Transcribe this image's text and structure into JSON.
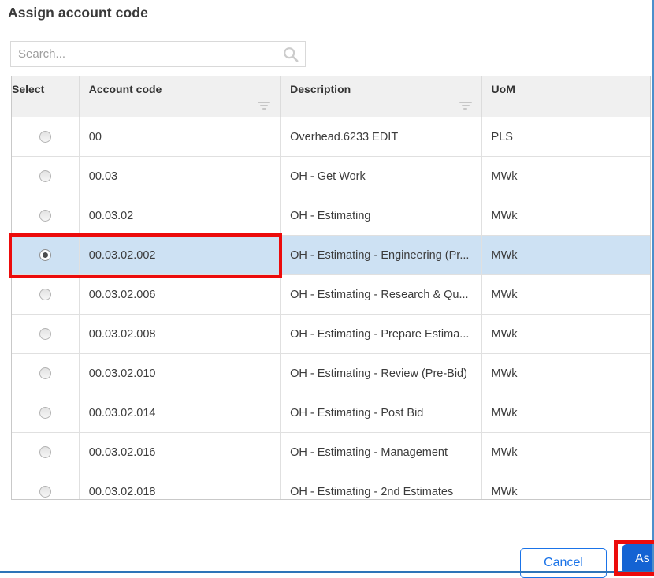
{
  "dialog": {
    "title": "Assign account code",
    "search": {
      "placeholder": "Search..."
    },
    "table": {
      "columns": [
        {
          "key": "select",
          "label": "Select",
          "filter": false
        },
        {
          "key": "code",
          "label": "Account code",
          "filter": true
        },
        {
          "key": "description",
          "label": "Description",
          "filter": true
        },
        {
          "key": "uom",
          "label": "UoM",
          "filter": false
        }
      ],
      "rows": [
        {
          "code": "00",
          "description": "Overhead.6233 EDIT",
          "uom": "PLS",
          "selected": false
        },
        {
          "code": "00.03",
          "description": "OH - Get Work",
          "uom": "MWk",
          "selected": false
        },
        {
          "code": "00.03.02",
          "description": "OH - Estimating",
          "uom": "MWk",
          "selected": false
        },
        {
          "code": "00.03.02.002",
          "description": "OH - Estimating - Engineering (Pr...",
          "uom": "MWk",
          "selected": true
        },
        {
          "code": "00.03.02.006",
          "description": "OH - Estimating - Research & Qu...",
          "uom": "MWk",
          "selected": false
        },
        {
          "code": "00.03.02.008",
          "description": "OH - Estimating - Prepare Estima...",
          "uom": "MWk",
          "selected": false
        },
        {
          "code": "00.03.02.010",
          "description": "OH - Estimating - Review (Pre-Bid)",
          "uom": "MWk",
          "selected": false
        },
        {
          "code": "00.03.02.014",
          "description": "OH - Estimating - Post Bid",
          "uom": "MWk",
          "selected": false
        },
        {
          "code": "00.03.02.016",
          "description": "OH - Estimating - Management",
          "uom": "MWk",
          "selected": false
        },
        {
          "code": "00.03.02.018",
          "description": "OH - Estimating - 2nd Estimates",
          "uom": "MWk",
          "selected": false
        }
      ]
    },
    "buttons": {
      "cancel": "Cancel",
      "assign_visible": "As"
    },
    "colors": {
      "accent_blue": "#1a73e8",
      "assign_button_bg": "#1463d3",
      "selected_row_bg": "#cde1f3",
      "header_bg": "#f0f0f0",
      "annotation_red": "#ec0b0b",
      "frame_blue": "#2e74b8"
    }
  }
}
